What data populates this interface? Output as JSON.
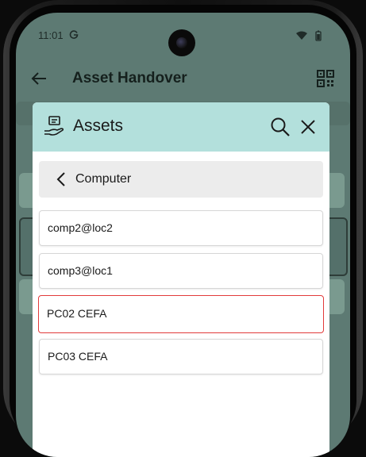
{
  "status_bar": {
    "time": "11:01"
  },
  "app_bar": {
    "title": "Asset Handover"
  },
  "dialog": {
    "title": "Assets",
    "category": "Computer",
    "items": [
      {
        "label": "comp2@loc2",
        "selected": false
      },
      {
        "label": "comp3@loc1",
        "selected": false
      },
      {
        "label": "PC02 CEFA",
        "selected": true
      },
      {
        "label": "PC03 CEFA",
        "selected": false
      }
    ]
  },
  "colors": {
    "header_bg": "#b3e0dc",
    "scrim_bg": "#5d7a73",
    "selected_border": "#e23b3b"
  }
}
